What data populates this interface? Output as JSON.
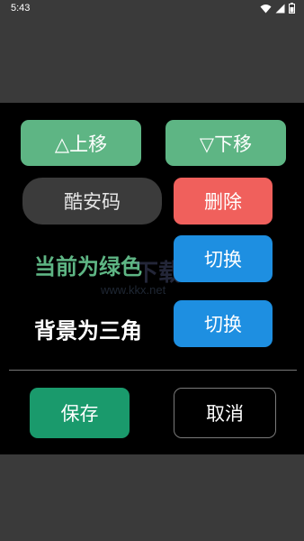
{
  "status_bar": {
    "time": "5:43",
    "icons": [
      "wifi-icon",
      "signal-icon",
      "battery-icon"
    ]
  },
  "controls": {
    "move_up_label": "△上移",
    "move_down_label": "▽下移",
    "name_value": "酷安码",
    "delete_label": "删除",
    "current_color_text": "当前为绿色",
    "current_color_hex": "#5eb584",
    "switch_color_label": "切换",
    "background_text": "背景为三角",
    "switch_background_label": "切换",
    "save_label": "保存",
    "cancel_label": "取消"
  },
  "watermark": {
    "text": "www.kkx.net"
  },
  "colors": {
    "green": "#5eb584",
    "red": "#f0605c",
    "blue": "#1e8fe1",
    "teal": "#1a9a6c"
  }
}
